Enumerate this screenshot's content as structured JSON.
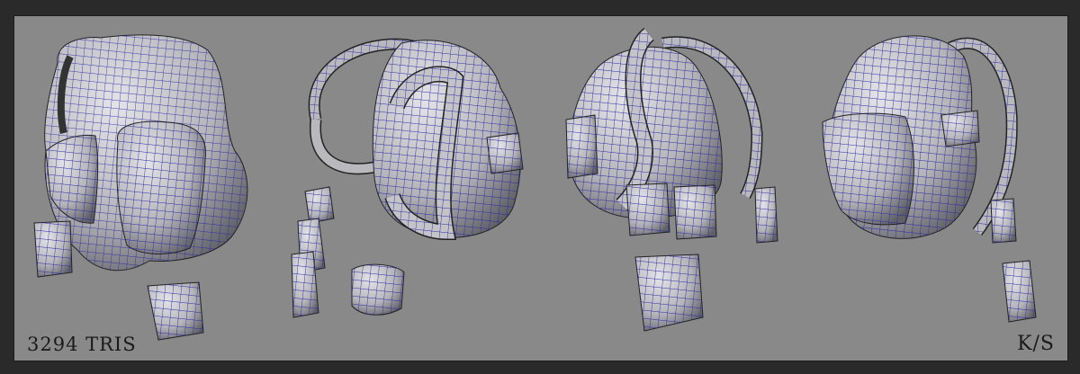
{
  "render": {
    "background_color": "#898989",
    "frame_color": "#2a2a2a",
    "mesh_fill": "#b9b9bd",
    "mesh_shade": "#6e6e74",
    "wire_color": "#2a2aa8",
    "views": [
      "front-three-quarter",
      "back-side",
      "back",
      "side-three-quarter"
    ]
  },
  "stats": {
    "triangle_count_label": "3294 TRIS"
  },
  "author": {
    "signature": "K/S"
  }
}
